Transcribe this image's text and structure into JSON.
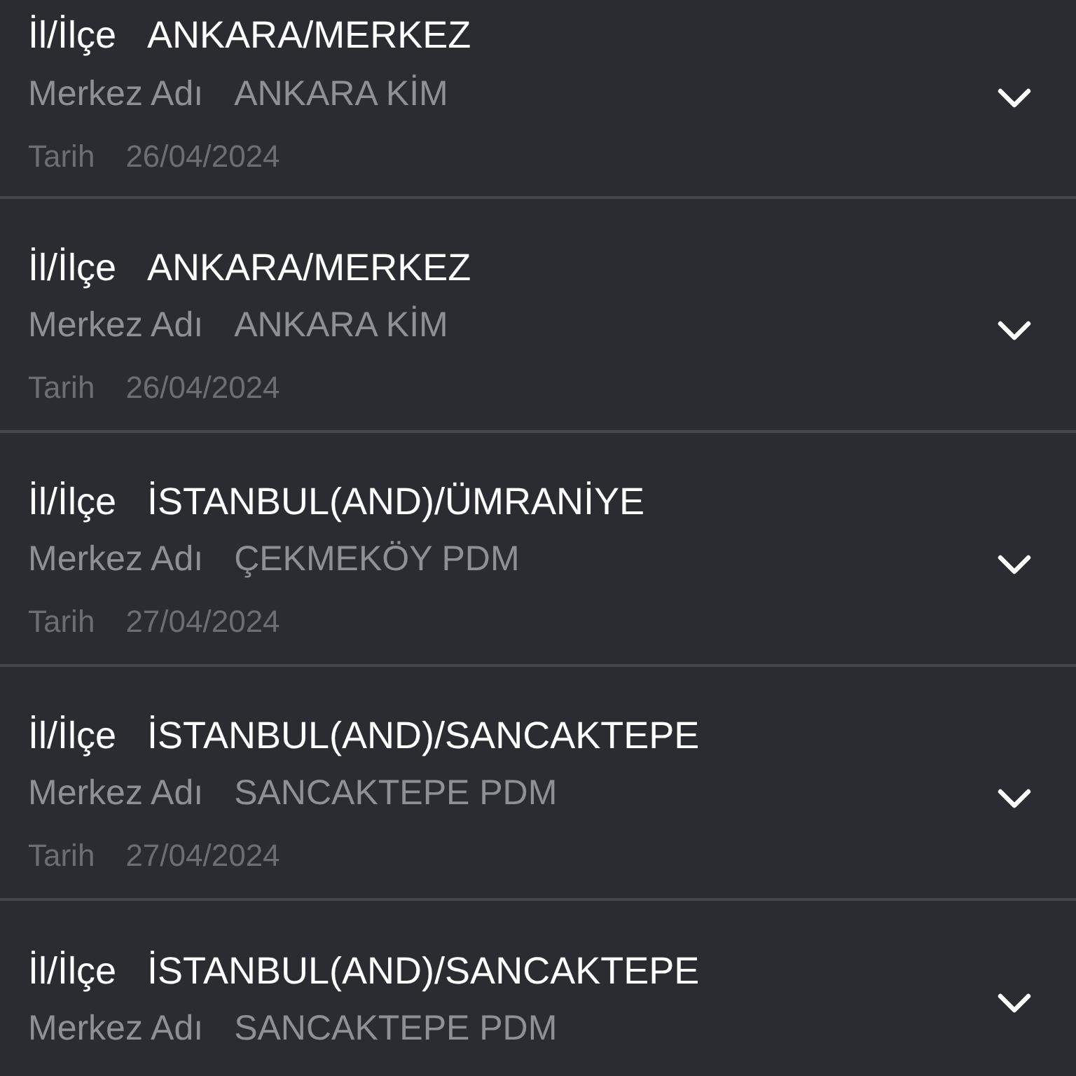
{
  "records": [
    {
      "location_label": "İl/İlçe",
      "location": "ANKARA/MERKEZ",
      "center_label": "Merkez Adı",
      "center": "ANKARA KİM",
      "date_label": "Tarih",
      "date": "26/04/2024",
      "expanded": false
    },
    {
      "location_label": "İl/İlçe",
      "location": "ANKARA/MERKEZ",
      "center_label": "Merkez Adı",
      "center": "ANKARA KİM",
      "date_label": "Tarih",
      "date": "26/04/2024",
      "expanded": false
    },
    {
      "location_label": "İl/İlçe",
      "location": "İSTANBUL(AND)/ÜMRANİYE",
      "center_label": "Merkez Adı",
      "center": "ÇEKMEKÖY PDM",
      "date_label": "Tarih",
      "date": "27/04/2024",
      "expanded": false
    },
    {
      "location_label": "İl/İlçe",
      "location": "İSTANBUL(AND)/SANCAKTEPE",
      "center_label": "Merkez Adı",
      "center": "SANCAKTEPE PDM",
      "date_label": "Tarih",
      "date": "27/04/2024",
      "expanded": false
    },
    {
      "location_label": "İl/İlçe",
      "location": "İSTANBUL(AND)/SANCAKTEPE",
      "center_label": "Merkez Adı",
      "center": "SANCAKTEPE PDM",
      "expanded": false
    }
  ]
}
